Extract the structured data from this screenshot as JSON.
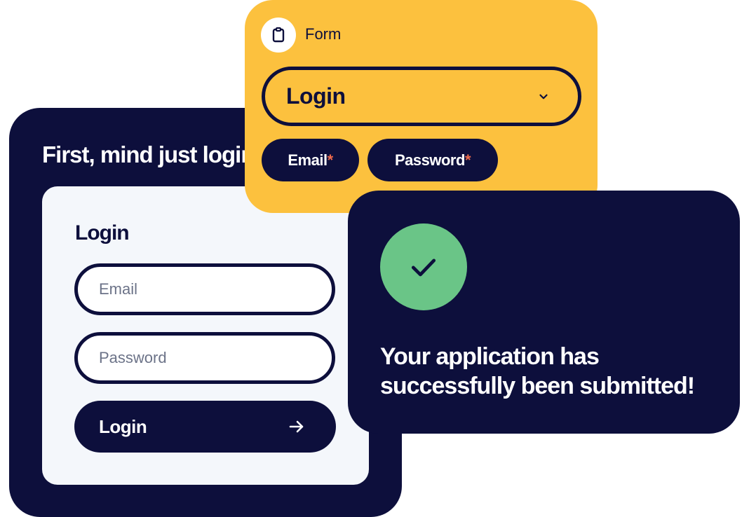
{
  "main_card": {
    "title": "First, mind just login"
  },
  "login_panel": {
    "heading": "Login",
    "email": {
      "placeholder": "Email",
      "value": ""
    },
    "password": {
      "placeholder": "Password",
      "value": ""
    },
    "submit_label": "Login",
    "submit_icon": "arrow-right-icon"
  },
  "form_card": {
    "badge_icon": "clipboard-icon",
    "label": "Form",
    "select_value": "Login",
    "select_icon": "chevron-down-icon",
    "chips": [
      {
        "label": "Email",
        "required_mark": "*"
      },
      {
        "label": "Password",
        "required_mark": "*"
      }
    ]
  },
  "success_card": {
    "icon": "check-icon",
    "message": "Your application has successfully been submitted!"
  },
  "colors": {
    "navy": "#0d0f3c",
    "yellow": "#fcc13e",
    "green": "#6ac587",
    "panel": "#f4f7fb",
    "required": "#ef6b4c"
  }
}
